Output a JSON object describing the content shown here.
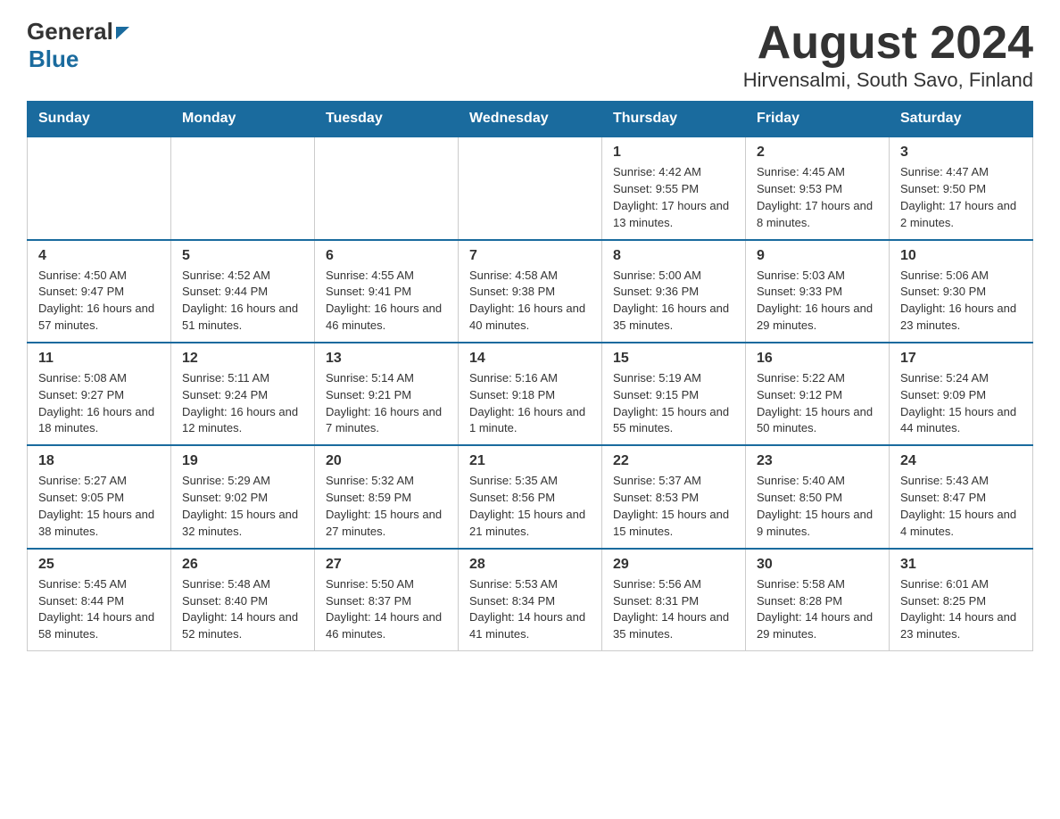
{
  "header": {
    "logo_general": "General",
    "logo_blue": "Blue",
    "month_title": "August 2024",
    "location": "Hirvensalmi, South Savo, Finland"
  },
  "weekdays": [
    "Sunday",
    "Monday",
    "Tuesday",
    "Wednesday",
    "Thursday",
    "Friday",
    "Saturday"
  ],
  "weeks": [
    [
      {
        "day": "",
        "info": ""
      },
      {
        "day": "",
        "info": ""
      },
      {
        "day": "",
        "info": ""
      },
      {
        "day": "",
        "info": ""
      },
      {
        "day": "1",
        "info": "Sunrise: 4:42 AM\nSunset: 9:55 PM\nDaylight: 17 hours and 13 minutes."
      },
      {
        "day": "2",
        "info": "Sunrise: 4:45 AM\nSunset: 9:53 PM\nDaylight: 17 hours and 8 minutes."
      },
      {
        "day": "3",
        "info": "Sunrise: 4:47 AM\nSunset: 9:50 PM\nDaylight: 17 hours and 2 minutes."
      }
    ],
    [
      {
        "day": "4",
        "info": "Sunrise: 4:50 AM\nSunset: 9:47 PM\nDaylight: 16 hours and 57 minutes."
      },
      {
        "day": "5",
        "info": "Sunrise: 4:52 AM\nSunset: 9:44 PM\nDaylight: 16 hours and 51 minutes."
      },
      {
        "day": "6",
        "info": "Sunrise: 4:55 AM\nSunset: 9:41 PM\nDaylight: 16 hours and 46 minutes."
      },
      {
        "day": "7",
        "info": "Sunrise: 4:58 AM\nSunset: 9:38 PM\nDaylight: 16 hours and 40 minutes."
      },
      {
        "day": "8",
        "info": "Sunrise: 5:00 AM\nSunset: 9:36 PM\nDaylight: 16 hours and 35 minutes."
      },
      {
        "day": "9",
        "info": "Sunrise: 5:03 AM\nSunset: 9:33 PM\nDaylight: 16 hours and 29 minutes."
      },
      {
        "day": "10",
        "info": "Sunrise: 5:06 AM\nSunset: 9:30 PM\nDaylight: 16 hours and 23 minutes."
      }
    ],
    [
      {
        "day": "11",
        "info": "Sunrise: 5:08 AM\nSunset: 9:27 PM\nDaylight: 16 hours and 18 minutes."
      },
      {
        "day": "12",
        "info": "Sunrise: 5:11 AM\nSunset: 9:24 PM\nDaylight: 16 hours and 12 minutes."
      },
      {
        "day": "13",
        "info": "Sunrise: 5:14 AM\nSunset: 9:21 PM\nDaylight: 16 hours and 7 minutes."
      },
      {
        "day": "14",
        "info": "Sunrise: 5:16 AM\nSunset: 9:18 PM\nDaylight: 16 hours and 1 minute."
      },
      {
        "day": "15",
        "info": "Sunrise: 5:19 AM\nSunset: 9:15 PM\nDaylight: 15 hours and 55 minutes."
      },
      {
        "day": "16",
        "info": "Sunrise: 5:22 AM\nSunset: 9:12 PM\nDaylight: 15 hours and 50 minutes."
      },
      {
        "day": "17",
        "info": "Sunrise: 5:24 AM\nSunset: 9:09 PM\nDaylight: 15 hours and 44 minutes."
      }
    ],
    [
      {
        "day": "18",
        "info": "Sunrise: 5:27 AM\nSunset: 9:05 PM\nDaylight: 15 hours and 38 minutes."
      },
      {
        "day": "19",
        "info": "Sunrise: 5:29 AM\nSunset: 9:02 PM\nDaylight: 15 hours and 32 minutes."
      },
      {
        "day": "20",
        "info": "Sunrise: 5:32 AM\nSunset: 8:59 PM\nDaylight: 15 hours and 27 minutes."
      },
      {
        "day": "21",
        "info": "Sunrise: 5:35 AM\nSunset: 8:56 PM\nDaylight: 15 hours and 21 minutes."
      },
      {
        "day": "22",
        "info": "Sunrise: 5:37 AM\nSunset: 8:53 PM\nDaylight: 15 hours and 15 minutes."
      },
      {
        "day": "23",
        "info": "Sunrise: 5:40 AM\nSunset: 8:50 PM\nDaylight: 15 hours and 9 minutes."
      },
      {
        "day": "24",
        "info": "Sunrise: 5:43 AM\nSunset: 8:47 PM\nDaylight: 15 hours and 4 minutes."
      }
    ],
    [
      {
        "day": "25",
        "info": "Sunrise: 5:45 AM\nSunset: 8:44 PM\nDaylight: 14 hours and 58 minutes."
      },
      {
        "day": "26",
        "info": "Sunrise: 5:48 AM\nSunset: 8:40 PM\nDaylight: 14 hours and 52 minutes."
      },
      {
        "day": "27",
        "info": "Sunrise: 5:50 AM\nSunset: 8:37 PM\nDaylight: 14 hours and 46 minutes."
      },
      {
        "day": "28",
        "info": "Sunrise: 5:53 AM\nSunset: 8:34 PM\nDaylight: 14 hours and 41 minutes."
      },
      {
        "day": "29",
        "info": "Sunrise: 5:56 AM\nSunset: 8:31 PM\nDaylight: 14 hours and 35 minutes."
      },
      {
        "day": "30",
        "info": "Sunrise: 5:58 AM\nSunset: 8:28 PM\nDaylight: 14 hours and 29 minutes."
      },
      {
        "day": "31",
        "info": "Sunrise: 6:01 AM\nSunset: 8:25 PM\nDaylight: 14 hours and 23 minutes."
      }
    ]
  ]
}
